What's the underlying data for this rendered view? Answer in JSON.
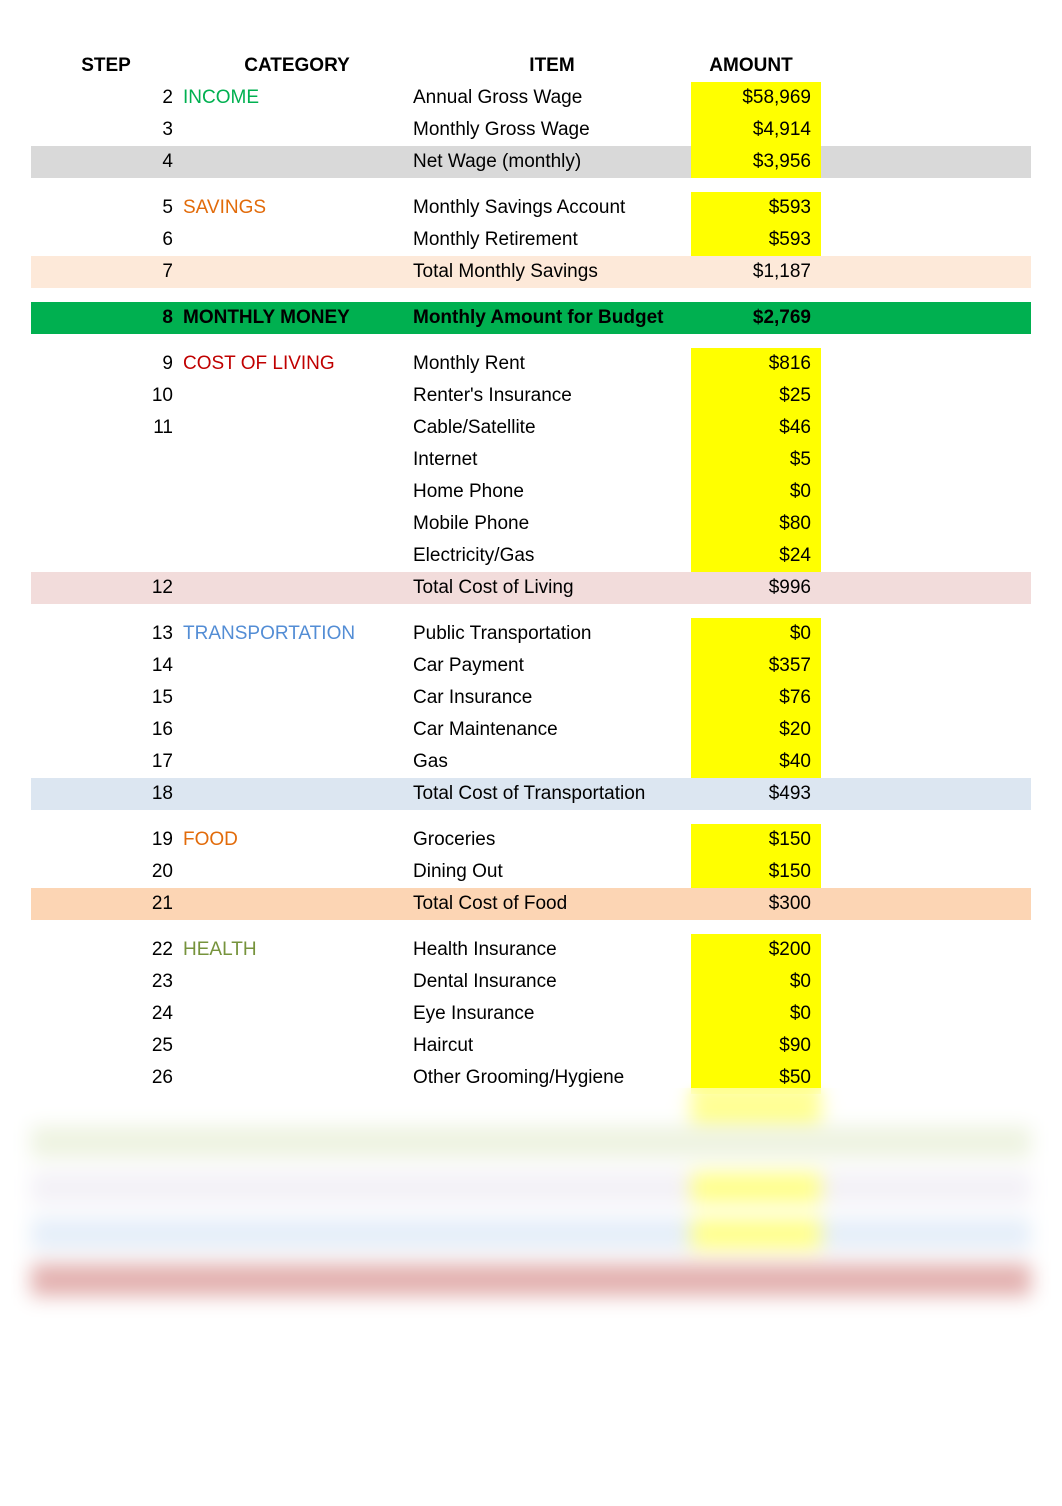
{
  "header": {
    "step": "STEP",
    "category": "CATEGORY",
    "item": "ITEM",
    "amount": "AMOUNT"
  },
  "rows": [
    {
      "step": "2",
      "category": "INCOME",
      "cat_class": "cat-income",
      "item": "Annual Gross Wage",
      "amount": "$58,969",
      "amt_yellow": true
    },
    {
      "step": "3",
      "category": "",
      "item": "Monthly Gross Wage",
      "amount": "$4,914",
      "amt_yellow": true
    },
    {
      "step": "4",
      "category": "",
      "item": "Net Wage (monthly)",
      "amount": "$3,956",
      "row_class": "row-grey",
      "amt_yellow": true
    },
    {
      "spacer": true
    },
    {
      "step": "5",
      "category": "SAVINGS",
      "cat_class": "cat-savings",
      "item": "Monthly Savings Account",
      "amount": "$593",
      "amt_yellow": true
    },
    {
      "step": "6",
      "category": "",
      "item": "Monthly Retirement",
      "amount": "$593",
      "amt_yellow": true
    },
    {
      "step": "7",
      "category": "",
      "item": "Total Monthly Savings",
      "amount": "$1,187",
      "row_class": "row-orange-light"
    },
    {
      "spacer": true
    },
    {
      "step": "8",
      "category": "MONTHLY MONEY",
      "item": "Monthly Amount for Budget",
      "amount": "$2,769",
      "row_class": "row-green-bright",
      "bold": true
    },
    {
      "spacer": true
    },
    {
      "step": "9",
      "category": "COST OF LIVING",
      "cat_class": "cat-col",
      "item": "Monthly Rent",
      "amount": "$816",
      "amt_yellow": true
    },
    {
      "step": "10",
      "category": "",
      "item": "Renter's Insurance",
      "amount": "$25",
      "amt_yellow": true
    },
    {
      "step": "11",
      "category": "",
      "item": "Cable/Satellite",
      "amount": "$46",
      "amt_yellow": true
    },
    {
      "step": "",
      "category": "",
      "item": "Internet",
      "amount": "$5",
      "amt_yellow": true
    },
    {
      "step": "",
      "category": "",
      "item": "Home Phone",
      "amount": "$0",
      "amt_yellow": true
    },
    {
      "step": "",
      "category": "",
      "item": "Mobile Phone",
      "amount": "$80",
      "amt_yellow": true
    },
    {
      "step": "",
      "category": "",
      "item": "Electricity/Gas",
      "amount": "$24",
      "amt_yellow": true
    },
    {
      "step": "12",
      "category": "",
      "item": "Total Cost of Living",
      "amount": "$996",
      "row_class": "row-red-light"
    },
    {
      "spacer": true
    },
    {
      "step": "13",
      "category": "TRANSPORTATION",
      "cat_class": "cat-trans",
      "item": "Public Transportation",
      "amount": "$0",
      "amt_yellow": true
    },
    {
      "step": "14",
      "category": "",
      "item": "Car Payment",
      "amount": "$357",
      "amt_yellow": true
    },
    {
      "step": "15",
      "category": "",
      "item": "Car Insurance",
      "amount": "$76",
      "amt_yellow": true
    },
    {
      "step": "16",
      "category": "",
      "item": "Car Maintenance",
      "amount": "$20",
      "amt_yellow": true
    },
    {
      "step": "17",
      "category": "",
      "item": "Gas",
      "amount": "$40",
      "amt_yellow": true
    },
    {
      "step": "18",
      "category": "",
      "item": "Total Cost of Transportation",
      "amount": "$493",
      "row_class": "row-blue-light"
    },
    {
      "spacer": true
    },
    {
      "step": "19",
      "category": "FOOD",
      "cat_class": "cat-food",
      "item": "Groceries",
      "amount": "$150",
      "amt_yellow": true
    },
    {
      "step": "20",
      "category": "",
      "item": "Dining Out",
      "amount": "$150",
      "amt_yellow": true
    },
    {
      "step": "21",
      "category": "",
      "item": "Total Cost of Food",
      "amount": "$300",
      "row_class": "row-orange-mid"
    },
    {
      "spacer": true
    },
    {
      "step": "22",
      "category": "HEALTH",
      "cat_class": "cat-health",
      "item": "Health Insurance",
      "amount": "$200",
      "amt_yellow": true
    },
    {
      "step": "23",
      "category": "",
      "item": "Dental Insurance",
      "amount": "$0",
      "amt_yellow": true
    },
    {
      "step": "24",
      "category": "",
      "item": "Eye Insurance",
      "amount": "$0",
      "amt_yellow": true
    },
    {
      "step": "25",
      "category": "",
      "item": "Haircut",
      "amount": "$90",
      "amt_yellow": true
    },
    {
      "step": "26",
      "category": "",
      "item": "Other Grooming/Hygiene",
      "amount": "$50",
      "amt_yellow": true
    }
  ],
  "blurred_rows": [
    {
      "step": "",
      "category": "",
      "item": "",
      "amount": "",
      "amt_yellow": true
    },
    {
      "step": "",
      "category": "",
      "item": "",
      "amount": "",
      "row_class": "row-green-light"
    },
    {
      "spacer": true
    },
    {
      "step": "",
      "category": "",
      "cat_class": "cat-purple",
      "item": "",
      "amount": "",
      "row_class": "row-purple-light",
      "amt_yellow": true
    },
    {
      "spacer": true
    },
    {
      "step": "",
      "category": "",
      "cat_class": "cat-blue2",
      "item": "",
      "amount": "",
      "row_class": "row-blue-mid",
      "amt_yellow": true
    },
    {
      "spacer": true
    },
    {
      "step": "",
      "category": "",
      "cat_class": "cat-red2",
      "item": "",
      "amount": "",
      "row_class": "row-red-strong"
    }
  ]
}
